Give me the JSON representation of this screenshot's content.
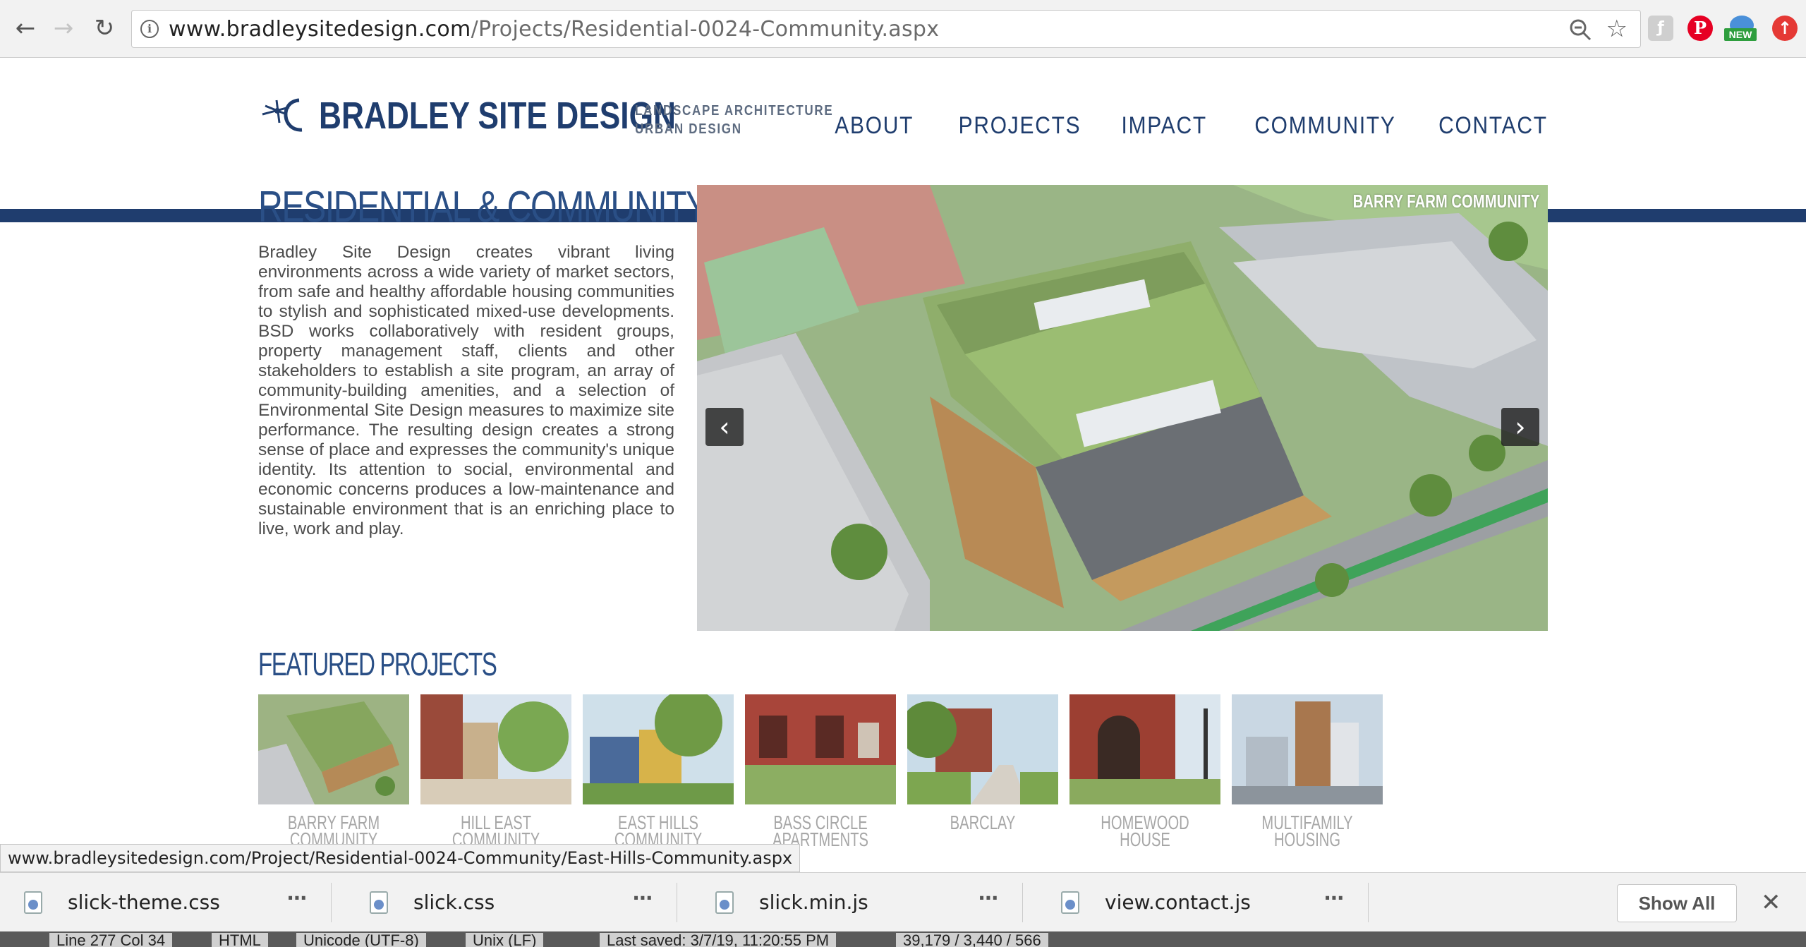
{
  "browser": {
    "url_domain": "www.bradleysitedesign.com",
    "url_path": "/Projects/Residential-0024-Community.aspx",
    "ext_new_badge": "NEW"
  },
  "site": {
    "logo_name": "BRADLEY SITE DESIGN",
    "logo_tag_line1": "LANDSCAPE ARCHITECTURE",
    "logo_tag_line2": "URBAN DESIGN",
    "nav": [
      "ABOUT",
      "PROJECTS",
      "IMPACT",
      "COMMUNITY",
      "CONTACT"
    ],
    "accent_color": "#1f3d6e"
  },
  "content": {
    "title": "RESIDENTIAL & COMMUNITY",
    "intro": "Bradley Site Design creates vibrant living environments across a wide variety of market sectors, from safe and healthy affordable housing communities to stylish and sophisticated mixed-use developments. BSD works collaboratively with resident groups, property management staff, clients and other stakeholders to establish a site program, an array of community-building amenities, and a selection of Environmental Site Design measures to maximize site performance. The resulting design creates a strong sense of place and expresses the community's unique identity. Its attention to social, environmental and economic concerns produces a low-maintenance and sustainable environment that is an enriching place to live, work and play.",
    "slide_caption": "BARRY FARM COMMUNITY",
    "featured_title": "FEATURED PROJECTS",
    "projects": [
      {
        "label": "BARRY FARM\nCOMMUNITY",
        "icon": "aerial-green-roof"
      },
      {
        "label": "HILL EAST\nCOMMUNITY",
        "icon": "street-trees"
      },
      {
        "label": "EAST HILLS\nCOMMUNITY",
        "icon": "houses-tree"
      },
      {
        "label": "BASS CIRCLE\nAPARTMENTS",
        "icon": "brick-townhouses"
      },
      {
        "label": "BARCLAY",
        "icon": "brick-walkway"
      },
      {
        "label": "HOMEWOOD HOUSE",
        "icon": "historic-building"
      },
      {
        "label": "MULTIFAMILY\nHOUSING",
        "icon": "tower-rendering"
      }
    ]
  },
  "status_url": "www.bradleysitedesign.com/Project/Residential-0024-Community/East-Hills-Community.aspx",
  "downloads": {
    "files": [
      "slick-theme.css",
      "slick.css",
      "slick.min.js",
      "view.contact.js"
    ],
    "show_all": "Show All"
  },
  "editor_status": [
    "Line 277 Col 34",
    "HTML",
    "Unicode (UTF-8)",
    "Unix (LF)",
    "Last saved: 3/7/19, 11:20:55 PM",
    "39,179 / 3,440 / 566"
  ]
}
